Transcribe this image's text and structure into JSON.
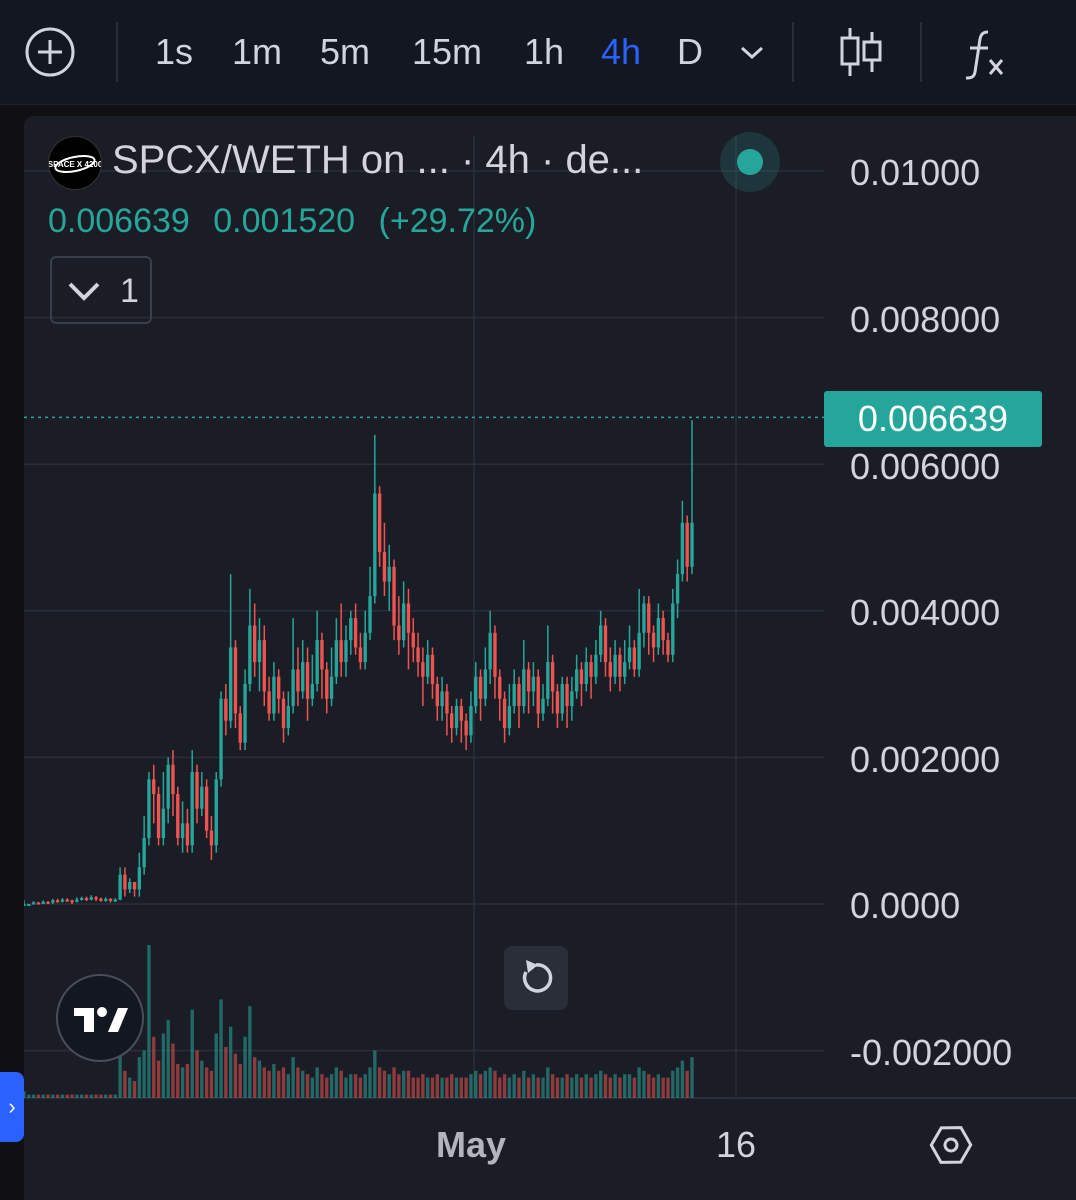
{
  "toolbar": {
    "add_label": "+",
    "intervals": [
      "1s",
      "1m",
      "5m",
      "15m",
      "1h",
      "4h",
      "D"
    ],
    "active_interval": "4h",
    "icons": [
      "plus-circle-icon",
      "chevron-down-icon",
      "candles-icon",
      "function-icon"
    ]
  },
  "legend": {
    "title": "SPCX/WETH on ... · 4h · de...",
    "logo_text": "SPACE X 4200",
    "last": "0.006639",
    "change": "0.001520",
    "change_pct": "(+29.72%)",
    "indicator_count": "1"
  },
  "price_tag": "0.006639",
  "colors": {
    "up": "#26a69a",
    "down": "#ef5350",
    "background": "#1b1d26",
    "grid": "#2a2e39",
    "accent": "#2962ff"
  },
  "chart_data": {
    "type": "candlestick",
    "y_axis": {
      "labels": [
        "0.01000",
        "0.008000",
        "0.006000",
        "0.004000",
        "0.002000",
        "0.0000",
        "-0.002000"
      ],
      "values": [
        0.01,
        0.008,
        0.006,
        0.004,
        0.002,
        0.0,
        -0.002
      ],
      "ylim": [
        -0.0026,
        0.0105
      ]
    },
    "x_axis": {
      "labels": [
        "May",
        "16"
      ]
    },
    "last_price": 0.006639,
    "grid": true,
    "volume_shown": true,
    "candles": [
      [
        0.0,
        0.0,
        5e-05,
        0.0
      ],
      [
        0.0,
        0.0,
        0.0,
        0.0
      ],
      [
        0.0,
        2e-05,
        4e-05,
        0.0
      ],
      [
        2e-05,
        0.0,
        3e-05,
        0.0
      ],
      [
        0.0,
        3e-05,
        5e-05,
        0.0
      ],
      [
        3e-05,
        2e-05,
        4e-05,
        0.0
      ],
      [
        2e-05,
        5e-05,
        7e-05,
        0.0
      ],
      [
        5e-05,
        4e-05,
        7e-05,
        2e-05
      ],
      [
        4e-05,
        6e-05,
        8e-05,
        2e-05
      ],
      [
        6e-05,
        5e-05,
        8e-05,
        3e-05
      ],
      [
        5e-05,
        3e-05,
        6e-05,
        0.0
      ],
      [
        3e-05,
        6e-05,
        9e-05,
        2e-05
      ],
      [
        6e-05,
        8e-05,
        0.0001,
        5e-05
      ],
      [
        8e-05,
        6e-05,
        0.0001,
        4e-05
      ],
      [
        6e-05,
        9e-05,
        0.00012,
        5e-05
      ],
      [
        9e-05,
        7e-05,
        0.00011,
        4e-05
      ],
      [
        7e-05,
        5e-05,
        9e-05,
        3e-05
      ],
      [
        5e-05,
        7e-05,
        9e-05,
        3e-05
      ],
      [
        7e-05,
        5e-05,
        8e-05,
        2e-05
      ],
      [
        5e-05,
        6e-05,
        8e-05,
        3e-05
      ],
      [
        6e-05,
        0.0004,
        0.0005,
        5e-05
      ],
      [
        0.0004,
        0.0002,
        0.0005,
        0.0001
      ],
      [
        0.0002,
        0.0003,
        0.00035,
        0.00015
      ],
      [
        0.0003,
        0.0002,
        0.0003,
        0.0001
      ],
      [
        0.0002,
        0.0005,
        0.0007,
        0.0001
      ],
      [
        0.0005,
        0.0009,
        0.0012,
        0.0004
      ],
      [
        0.0009,
        0.0017,
        0.0018,
        0.0008
      ],
      [
        0.0017,
        0.0015,
        0.0019,
        0.0011
      ],
      [
        0.0015,
        0.0009,
        0.0016,
        0.0008
      ],
      [
        0.0009,
        0.0013,
        0.0018,
        0.0008
      ],
      [
        0.0013,
        0.0019,
        0.002,
        0.0011
      ],
      [
        0.0019,
        0.0015,
        0.0021,
        0.0012
      ],
      [
        0.0015,
        0.0009,
        0.0016,
        0.0008
      ],
      [
        0.0009,
        0.0011,
        0.0014,
        0.0007
      ],
      [
        0.0011,
        0.0008,
        0.0013,
        0.0007
      ],
      [
        0.0008,
        0.0018,
        0.0021,
        0.0007
      ],
      [
        0.0018,
        0.0013,
        0.0019,
        0.0011
      ],
      [
        0.0013,
        0.0016,
        0.0018,
        0.0012
      ],
      [
        0.0016,
        0.001,
        0.0017,
        0.0009
      ],
      [
        0.001,
        0.0008,
        0.0012,
        0.0006
      ],
      [
        0.0008,
        0.0017,
        0.0018,
        0.0007
      ],
      [
        0.0017,
        0.0028,
        0.0029,
        0.0016
      ],
      [
        0.0028,
        0.0025,
        0.003,
        0.0023
      ],
      [
        0.0025,
        0.0035,
        0.0045,
        0.0024
      ],
      [
        0.0035,
        0.0026,
        0.0036,
        0.0024
      ],
      [
        0.0026,
        0.0022,
        0.0027,
        0.0021
      ],
      [
        0.0022,
        0.003,
        0.0032,
        0.0021
      ],
      [
        0.003,
        0.0038,
        0.0043,
        0.0029
      ],
      [
        0.0038,
        0.0033,
        0.0041,
        0.0031
      ],
      [
        0.0033,
        0.0036,
        0.0039,
        0.0029
      ],
      [
        0.0036,
        0.0029,
        0.0038,
        0.0027
      ],
      [
        0.0029,
        0.0026,
        0.0031,
        0.0025
      ],
      [
        0.0026,
        0.0031,
        0.0033,
        0.0025
      ],
      [
        0.0031,
        0.0028,
        0.0032,
        0.0026
      ],
      [
        0.0028,
        0.0024,
        0.0029,
        0.0022
      ],
      [
        0.0024,
        0.0027,
        0.0029,
        0.0023
      ],
      [
        0.0027,
        0.0032,
        0.0039,
        0.0026
      ],
      [
        0.0032,
        0.0029,
        0.0035,
        0.0027
      ],
      [
        0.0029,
        0.0033,
        0.0036,
        0.0028
      ],
      [
        0.0033,
        0.0028,
        0.0035,
        0.0025
      ],
      [
        0.0028,
        0.003,
        0.0034,
        0.0027
      ],
      [
        0.003,
        0.0036,
        0.004,
        0.0029
      ],
      [
        0.0036,
        0.0032,
        0.0037,
        0.0028
      ],
      [
        0.0032,
        0.0028,
        0.0033,
        0.0026
      ],
      [
        0.0028,
        0.0031,
        0.0035,
        0.0027
      ],
      [
        0.0031,
        0.0036,
        0.0039,
        0.003
      ],
      [
        0.0036,
        0.0033,
        0.0041,
        0.0031
      ],
      [
        0.0033,
        0.0036,
        0.0038,
        0.0031
      ],
      [
        0.0036,
        0.0039,
        0.004,
        0.0034
      ],
      [
        0.0039,
        0.0035,
        0.0041,
        0.0034
      ],
      [
        0.0035,
        0.0033,
        0.0037,
        0.0032
      ],
      [
        0.0033,
        0.0037,
        0.004,
        0.0032
      ],
      [
        0.0037,
        0.0042,
        0.0046,
        0.0036
      ],
      [
        0.0042,
        0.0056,
        0.0064,
        0.0041
      ],
      [
        0.0056,
        0.0048,
        0.0057,
        0.0046
      ],
      [
        0.0048,
        0.0044,
        0.0052,
        0.0042
      ],
      [
        0.0044,
        0.0046,
        0.0049,
        0.004
      ],
      [
        0.0046,
        0.0038,
        0.0047,
        0.0036
      ],
      [
        0.0038,
        0.0036,
        0.0042,
        0.0034
      ],
      [
        0.0036,
        0.0041,
        0.0044,
        0.0035
      ],
      [
        0.0041,
        0.0037,
        0.0043,
        0.0032
      ],
      [
        0.0037,
        0.0035,
        0.0039,
        0.0033
      ],
      [
        0.0035,
        0.0033,
        0.0037,
        0.0031
      ],
      [
        0.0033,
        0.0031,
        0.0035,
        0.0027
      ],
      [
        0.0031,
        0.0034,
        0.0036,
        0.003
      ],
      [
        0.0034,
        0.003,
        0.0035,
        0.0028
      ],
      [
        0.003,
        0.0027,
        0.0031,
        0.0025
      ],
      [
        0.0027,
        0.0029,
        0.0031,
        0.0025
      ],
      [
        0.0029,
        0.0026,
        0.003,
        0.0023
      ],
      [
        0.0026,
        0.0024,
        0.0027,
        0.0022
      ],
      [
        0.0024,
        0.0027,
        0.0028,
        0.0023
      ],
      [
        0.0027,
        0.0025,
        0.0028,
        0.0022
      ],
      [
        0.0025,
        0.0023,
        0.0026,
        0.0021
      ],
      [
        0.0023,
        0.0027,
        0.0029,
        0.0022
      ],
      [
        0.0027,
        0.0031,
        0.0033,
        0.0026
      ],
      [
        0.0031,
        0.0028,
        0.0032,
        0.0025
      ],
      [
        0.0028,
        0.0032,
        0.0035,
        0.0027
      ],
      [
        0.0032,
        0.0037,
        0.004,
        0.003
      ],
      [
        0.0037,
        0.0031,
        0.0038,
        0.0028
      ],
      [
        0.0031,
        0.0028,
        0.0032,
        0.0025
      ],
      [
        0.0028,
        0.0024,
        0.0029,
        0.0022
      ],
      [
        0.0024,
        0.0027,
        0.003,
        0.0023
      ],
      [
        0.0027,
        0.003,
        0.0032,
        0.0026
      ],
      [
        0.003,
        0.0027,
        0.0031,
        0.0024
      ],
      [
        0.0027,
        0.0032,
        0.0036,
        0.0026
      ],
      [
        0.0032,
        0.0029,
        0.0033,
        0.0026
      ],
      [
        0.0029,
        0.0031,
        0.0033,
        0.0027
      ],
      [
        0.0031,
        0.0026,
        0.0032,
        0.0024
      ],
      [
        0.0026,
        0.0028,
        0.003,
        0.0025
      ],
      [
        0.0028,
        0.0033,
        0.0038,
        0.0027
      ],
      [
        0.0033,
        0.0029,
        0.0034,
        0.0026
      ],
      [
        0.0029,
        0.0026,
        0.003,
        0.0024
      ],
      [
        0.0026,
        0.003,
        0.0031,
        0.0025
      ],
      [
        0.003,
        0.0027,
        0.0031,
        0.0024
      ],
      [
        0.0027,
        0.0029,
        0.0031,
        0.0025
      ],
      [
        0.0029,
        0.0032,
        0.0034,
        0.0028
      ],
      [
        0.0032,
        0.003,
        0.0033,
        0.0027
      ],
      [
        0.003,
        0.0033,
        0.0035,
        0.0029
      ],
      [
        0.0033,
        0.0031,
        0.0034,
        0.0028
      ],
      [
        0.0031,
        0.0034,
        0.0036,
        0.003
      ],
      [
        0.0034,
        0.0038,
        0.004,
        0.0033
      ],
      [
        0.0038,
        0.0033,
        0.0039,
        0.0031
      ],
      [
        0.0033,
        0.0031,
        0.0035,
        0.0029
      ],
      [
        0.0031,
        0.0034,
        0.0036,
        0.003
      ],
      [
        0.0034,
        0.0031,
        0.0035,
        0.0029
      ],
      [
        0.0031,
        0.0033,
        0.0036,
        0.003
      ],
      [
        0.0033,
        0.0035,
        0.0038,
        0.0032
      ],
      [
        0.0035,
        0.0032,
        0.0036,
        0.0031
      ],
      [
        0.0032,
        0.0037,
        0.0043,
        0.0031
      ],
      [
        0.0037,
        0.0041,
        0.0042,
        0.0035
      ],
      [
        0.0041,
        0.0037,
        0.0042,
        0.0034
      ],
      [
        0.0037,
        0.0035,
        0.0038,
        0.0033
      ],
      [
        0.0035,
        0.0039,
        0.0041,
        0.0034
      ],
      [
        0.0039,
        0.0036,
        0.004,
        0.0034
      ],
      [
        0.0036,
        0.0034,
        0.0037,
        0.0033
      ],
      [
        0.0034,
        0.0041,
        0.0043,
        0.0033
      ],
      [
        0.0041,
        0.0045,
        0.0047,
        0.0039
      ],
      [
        0.0045,
        0.0052,
        0.0055,
        0.0044
      ],
      [
        0.0052,
        0.0046,
        0.0053,
        0.0044
      ],
      [
        0.0046,
        0.0052,
        0.0066,
        0.0045
      ]
    ],
    "volumes": [
      0.2,
      0.1,
      0.1,
      0.1,
      0.1,
      0.1,
      0.1,
      0.1,
      0.1,
      0.1,
      0.1,
      0.1,
      0.1,
      0.1,
      0.1,
      0.1,
      0.1,
      0.1,
      0.1,
      0.1,
      2.2,
      0.8,
      0.6,
      0.5,
      1.2,
      1.4,
      4.5,
      1.8,
      1.1,
      1.9,
      2.3,
      1.6,
      1.0,
      0.9,
      1.0,
      2.6,
      1.4,
      1.1,
      0.9,
      0.8,
      1.9,
      2.9,
      1.5,
      2.1,
      1.3,
      1.0,
      1.8,
      2.7,
      1.2,
      1.1,
      0.9,
      0.8,
      1.0,
      0.8,
      0.9,
      0.7,
      1.2,
      0.9,
      0.8,
      0.7,
      0.6,
      0.9,
      0.7,
      0.6,
      0.7,
      0.9,
      0.8,
      0.6,
      0.7,
      0.7,
      0.6,
      0.7,
      0.9,
      1.4,
      0.9,
      0.8,
      0.7,
      0.9,
      0.7,
      0.8,
      0.8,
      0.6,
      0.6,
      0.7,
      0.6,
      0.6,
      0.7,
      0.6,
      0.6,
      0.7,
      0.6,
      0.6,
      0.6,
      0.7,
      0.8,
      0.7,
      0.8,
      0.9,
      0.8,
      0.6,
      0.7,
      0.6,
      0.7,
      0.6,
      0.8,
      0.6,
      0.7,
      0.6,
      0.6,
      0.9,
      0.7,
      0.6,
      0.6,
      0.7,
      0.6,
      0.7,
      0.6,
      0.7,
      0.6,
      0.7,
      0.8,
      0.7,
      0.6,
      0.7,
      0.6,
      0.7,
      0.7,
      0.6,
      0.9,
      0.8,
      0.7,
      0.6,
      0.7,
      0.6,
      0.6,
      0.8,
      0.9,
      1.1,
      0.8,
      1.2
    ]
  },
  "axis": {
    "x_may": "May",
    "x_16": "16"
  }
}
